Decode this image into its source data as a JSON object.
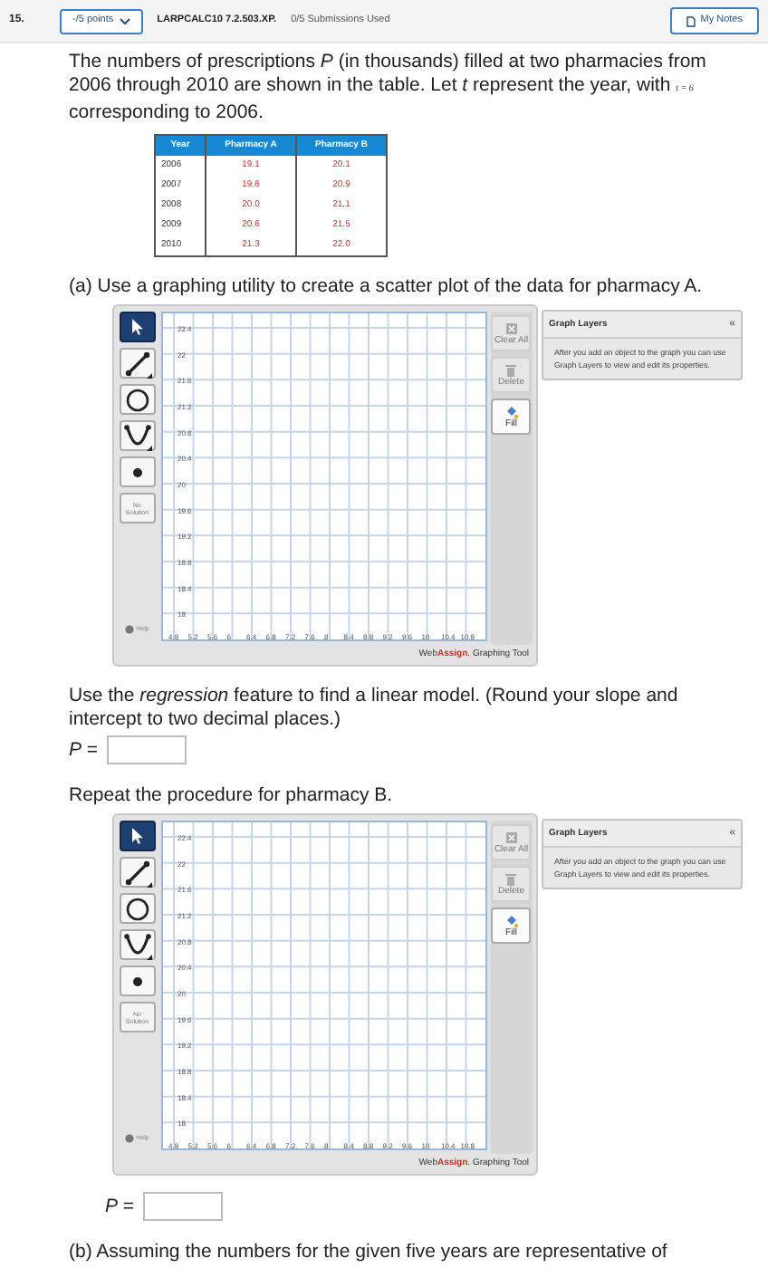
{
  "question": {
    "number": "15.",
    "points": "-/5 points",
    "code": "LARPCALC10 7.2.503.XP.",
    "submissions": "0/5 Submissions Used",
    "notes_button": "My Notes"
  },
  "intro": {
    "before": "The numbers of prescriptions *P* (in thousands) filled at two pharmacies from 2006 through 2010 are shown in the table. Let *t* represent the year, with",
    "math": "t = 6",
    "after": "corresponding to 2006."
  },
  "table": {
    "columns": [
      "Year",
      "Pharmacy A",
      "Pharmacy B"
    ],
    "rows": [
      [
        "2006",
        "19.1",
        "20.1"
      ],
      [
        "2007",
        "19.6",
        "20.9"
      ],
      [
        "2008",
        "20.0",
        "21.1"
      ],
      [
        "2009",
        "20.6",
        "21.5"
      ],
      [
        "2010",
        "21.3",
        "22.0"
      ]
    ]
  },
  "blocks": [
    {
      "kind": "text",
      "text": "(a) Use a graphing utility to create a scatter plot of the data for pharmacy A."
    },
    {
      "kind": "graph",
      "tools": [
        {
          "kind": "pointer",
          "selected": true
        },
        {
          "kind": "line",
          "selected": false
        },
        {
          "kind": "circle",
          "selected": false
        },
        {
          "kind": "parabola",
          "selected": false
        },
        {
          "kind": "point",
          "selected": false
        },
        {
          "kind": "none",
          "label": "No Solution",
          "selected": false
        }
      ],
      "help": "Help",
      "y_ticks": [
        "22.4",
        "22",
        "21.6",
        "21.2",
        "20.8",
        "20.4",
        "20",
        "19.6",
        "19.2",
        "18.8",
        "18.4",
        "18"
      ],
      "x_ticks": [
        "4.8",
        "5.2",
        "5.6",
        "6",
        "6.4",
        "6.8",
        "7.2",
        "7.6",
        "8",
        "8.4",
        "8.8",
        "9.2",
        "9.6",
        "10",
        "10.4",
        "10.8"
      ],
      "actions": [
        {
          "kind": "clear",
          "label": "Clear All",
          "disabled": true
        },
        {
          "kind": "delete",
          "label": "Delete",
          "disabled": true
        },
        {
          "kind": "fill",
          "label": "Fill",
          "disabled": false
        }
      ],
      "layers": {
        "title": "Graph Layers",
        "collapse": "«",
        "message": "After you add an object to the graph you can use Graph Layers to view and edit its properties."
      },
      "brand": {
        "first": "Web",
        "second": "Assign",
        "rest": ". Graphing Tool"
      }
    },
    {
      "kind": "text",
      "text": "Use the *regression* feature to find a linear model. (Round your slope and intercept to two decimal places.)"
    },
    {
      "kind": "answer",
      "label": "*P* =",
      "indent": false
    },
    {
      "kind": "text",
      "text": "Repeat the procedure for pharmacy B."
    },
    {
      "kind": "graph",
      "tools": [
        {
          "kind": "pointer",
          "selected": true
        },
        {
          "kind": "line",
          "selected": false
        },
        {
          "kind": "circle",
          "selected": false
        },
        {
          "kind": "parabola",
          "selected": false
        },
        {
          "kind": "point",
          "selected": false
        },
        {
          "kind": "none",
          "label": "No Solution",
          "selected": false
        }
      ],
      "help": "Help",
      "y_ticks": [
        "22.4",
        "22",
        "21.6",
        "21.2",
        "20.8",
        "20.4",
        "20",
        "19.6",
        "19.2",
        "18.8",
        "18.4",
        "18"
      ],
      "x_ticks": [
        "4.8",
        "5.2",
        "5.6",
        "6",
        "6.4",
        "6.8",
        "7.2",
        "7.6",
        "8",
        "8.4",
        "8.8",
        "9.2",
        "9.6",
        "10",
        "10.4",
        "10.8"
      ],
      "actions": [
        {
          "kind": "clear",
          "label": "Clear All",
          "disabled": true
        },
        {
          "kind": "delete",
          "label": "Delete",
          "disabled": true
        },
        {
          "kind": "fill",
          "label": "Fill",
          "disabled": false
        }
      ],
      "layers": {
        "title": "Graph Layers",
        "collapse": "«",
        "message": "After you add an object to the graph you can use Graph Layers to view and edit its properties."
      },
      "brand": {
        "first": "Web",
        "second": "Assign",
        "rest": ". Graphing Tool"
      }
    },
    {
      "kind": "answer",
      "label": "*P* =",
      "indent": true
    },
    {
      "kind": "text",
      "text": "(b) Assuming the numbers for the given five years are representative of"
    }
  ]
}
